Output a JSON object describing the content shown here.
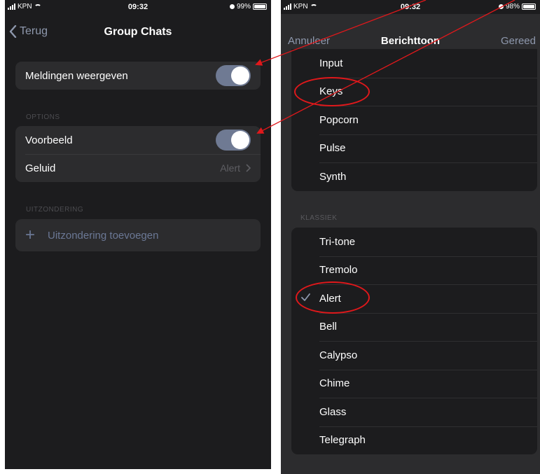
{
  "left": {
    "status": {
      "carrier": "KPN",
      "time": "09:32",
      "battery": "99%",
      "battery_level": 0.99
    },
    "nav": {
      "back_label": "Terug",
      "title": "Group Chats"
    },
    "notifications": {
      "label": "Meldingen weergeven",
      "on": true
    },
    "options": {
      "section": "OPTIONS",
      "preview_label": "Voorbeeld",
      "preview_on": true,
      "sound_label": "Geluid",
      "sound_value": "Alert"
    },
    "exceptions": {
      "section": "UITZONDERING",
      "add_label": "Uitzondering toevoegen"
    }
  },
  "right": {
    "status": {
      "carrier": "KPN",
      "time": "09:32",
      "battery": "98%",
      "battery_level": 0.98
    },
    "nav": {
      "cancel_label": "Annuleer",
      "title": "Berichttoon",
      "done_label": "Gereed"
    },
    "tones": [
      "Input",
      "Keys",
      "Popcorn",
      "Pulse",
      "Synth"
    ],
    "classic": {
      "section": "KLASSIEK",
      "items": [
        "Tri-tone",
        "Tremolo",
        "Alert",
        "Bell",
        "Calypso",
        "Chime",
        "Glass",
        "Telegraph"
      ],
      "selected": "Alert"
    }
  },
  "colors": {
    "accent": "#8e98ad",
    "annotation": "#e0181b",
    "toggle_on": "#6f7a93"
  }
}
